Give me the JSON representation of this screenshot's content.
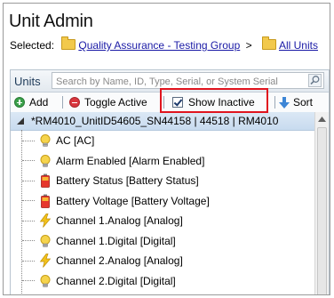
{
  "page": {
    "title": "Unit Admin"
  },
  "selected": {
    "label": "Selected:",
    "path": [
      {
        "label": "Quality Assurance - Testing Group"
      },
      {
        "label": "All Units"
      }
    ],
    "separator": ">"
  },
  "units_panel": {
    "header_label": "Units",
    "search_placeholder": "Search by Name, ID, Type, Serial, or System Serial"
  },
  "toolbar": {
    "add_label": "Add",
    "toggle_active_label": "Toggle Active",
    "show_inactive_label": "Show Inactive",
    "show_inactive_checked": true,
    "sort_label": "Sort",
    "separator": "|"
  },
  "tree": {
    "root": {
      "label": "*RM4010_UnitID54605_SN44158 | 44518 | RM4010",
      "icon": "device-icon"
    },
    "items": [
      {
        "label": "AC [AC]",
        "icon": "bulb-icon"
      },
      {
        "label": "Alarm Enabled [Alarm Enabled]",
        "icon": "bulb-icon"
      },
      {
        "label": "Battery Status [Battery Status]",
        "icon": "battery-icon"
      },
      {
        "label": "Battery Voltage [Battery Voltage]",
        "icon": "battery-icon"
      },
      {
        "label": "Channel 1.Analog [Analog]",
        "icon": "lightning-icon"
      },
      {
        "label": "Channel 1.Digital [Digital]",
        "icon": "bulb-icon"
      },
      {
        "label": "Channel 2.Analog [Analog]",
        "icon": "lightning-icon"
      },
      {
        "label": "Channel 2.Digital [Digital]",
        "icon": "bulb-icon"
      }
    ]
  },
  "colors": {
    "highlight_border": "#e0141e",
    "link": "#1a1aa6",
    "root_row_bg": "#c8dbef"
  }
}
